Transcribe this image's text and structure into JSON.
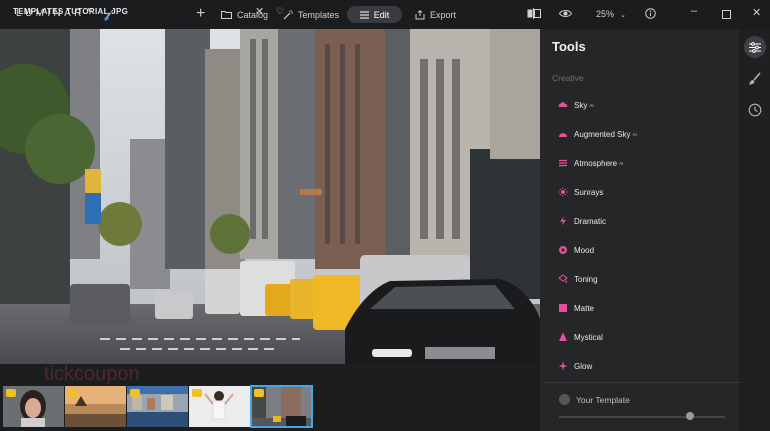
{
  "app": {
    "brand": "LUMINAR",
    "brand_sup": "AI"
  },
  "nav": {
    "catalog": "Catalog",
    "templates": "Templates",
    "edit": "Edit",
    "export": "Export"
  },
  "toolbar": {
    "zoom": "25%"
  },
  "panel": {
    "title": "Tools",
    "section": "Creative",
    "tools": [
      {
        "label": "Sky",
        "ai": "AI",
        "icon": "sky-icon"
      },
      {
        "label": "Augmented Sky",
        "ai": "AI",
        "icon": "augmented-sky-icon"
      },
      {
        "label": "Atmosphere",
        "ai": "AI",
        "icon": "atmosphere-icon"
      },
      {
        "label": "Sunrays",
        "ai": "",
        "icon": "sunrays-icon"
      },
      {
        "label": "Dramatic",
        "ai": "",
        "icon": "dramatic-icon"
      },
      {
        "label": "Mood",
        "ai": "",
        "icon": "mood-icon"
      },
      {
        "label": "Toning",
        "ai": "",
        "icon": "toning-icon"
      },
      {
        "label": "Matte",
        "ai": "",
        "icon": "matte-icon"
      },
      {
        "label": "Mystical",
        "ai": "",
        "icon": "mystical-icon"
      },
      {
        "label": "Glow",
        "ai": "",
        "icon": "glow-icon"
      }
    ],
    "your_template": "Your Template",
    "accent": "#e84f9c"
  },
  "filmstrip": {
    "title": "TEMPLATES TUTORIAL.JPG",
    "thumbs": [
      "portrait",
      "sunset-beach",
      "harbor-city",
      "woman-white",
      "street-city"
    ],
    "selected_index": 4
  },
  "watermark": "tickcoupon"
}
